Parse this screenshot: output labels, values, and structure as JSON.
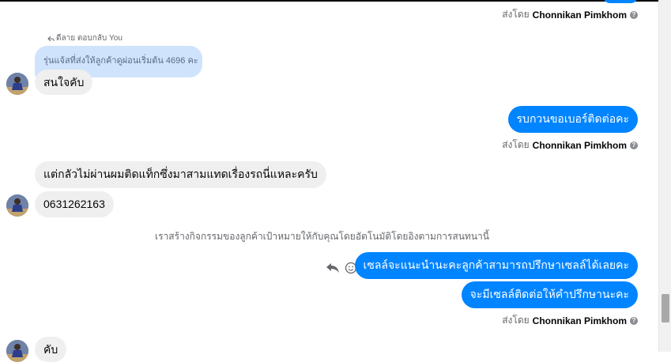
{
  "conversation": {
    "sent_by_label": "ส่งโดย",
    "agent_name": "Chonnikan Pimkhom",
    "reply_label": "ดีลาย ตอบกลับ You",
    "quoted_message": "รุ่นแจ้สที่ส่งให้ลูกค้าดูผ่อนเริ่มต้น 4696 คะ",
    "messages": [
      {
        "side": "in",
        "text": "สนใจคับ"
      },
      {
        "side": "out",
        "text": "รบกวนขอเบอร์ติดต่อคะ"
      },
      {
        "side": "in",
        "text": "แต่กลัวไม่ผ่านผมติดแท็กซึ่งมาสามแทดเรื่องรถนี่แหละครับ"
      },
      {
        "side": "in",
        "text": "0631262163"
      },
      {
        "side": "out",
        "text": "เซลล์จะแนะนำนะคะลูกค้าสามารถปรึกษาเซลล์ได้เลยคะ"
      },
      {
        "side": "out",
        "text": "จะมีเซลล์ติดต่อให้คำปรึกษานะคะ"
      },
      {
        "side": "in",
        "text": "คับ"
      }
    ],
    "system_notice": "เราสร้างกิจกรรมของลูกค้าเป้าหมายให้กับคุณโดยอัตโนมัติโดยอิงตามการสนทนานี้"
  },
  "colors": {
    "outgoing_bubble": "#0084ff",
    "incoming_bubble": "#efefef",
    "quoted_bubble": "#cfe3fc"
  },
  "icons": {
    "info": "question-circle-icon",
    "reply": "reply-arrow-icon",
    "react": "smiley-icon",
    "reply_indicator": "reply-indicator-icon"
  }
}
